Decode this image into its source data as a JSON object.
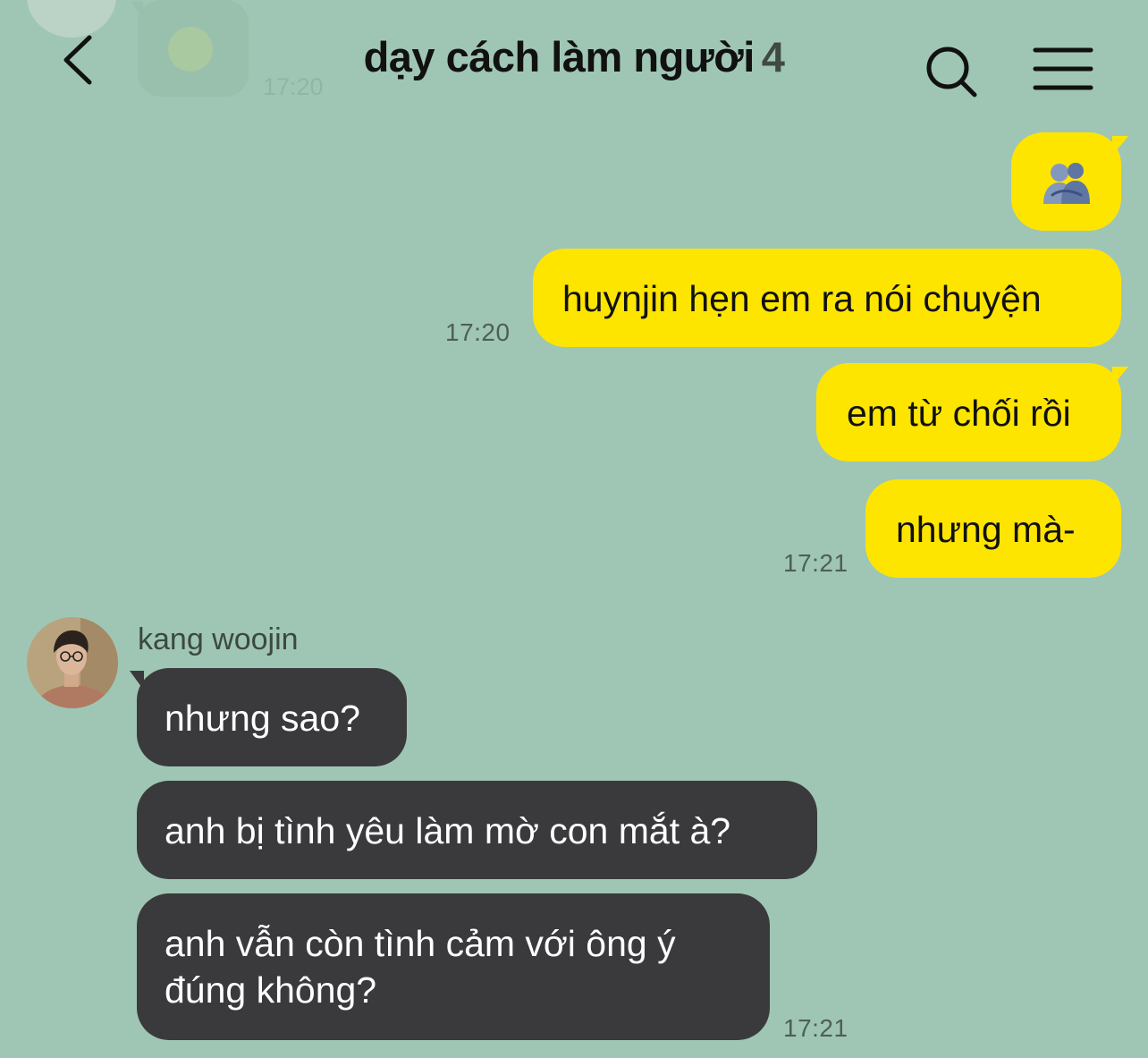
{
  "header": {
    "title": "dạy cách làm người",
    "member_count": "4"
  },
  "previous": {
    "time": "17:20"
  },
  "messages": {
    "m1": {
      "icon": "hug-emoji"
    },
    "m2": {
      "text": "huynjin hẹn em ra nói chuyện",
      "time": "17:20"
    },
    "m3": {
      "text": "em từ chối rồi"
    },
    "m4": {
      "text": "nhưng mà-",
      "time": "17:21"
    },
    "sender_name": "kang woojin",
    "m5": {
      "text": "nhưng sao?"
    },
    "m6": {
      "text": "anh bị tình yêu làm mờ con mắt à?"
    },
    "m7": {
      "line1": "anh vẫn còn tình cảm với ông ý",
      "line2": "đúng không?",
      "time": "17:21"
    }
  },
  "colors": {
    "background": "#9fc6b4",
    "my_bubble": "#fee500",
    "their_bubble": "#3a3a3d"
  }
}
